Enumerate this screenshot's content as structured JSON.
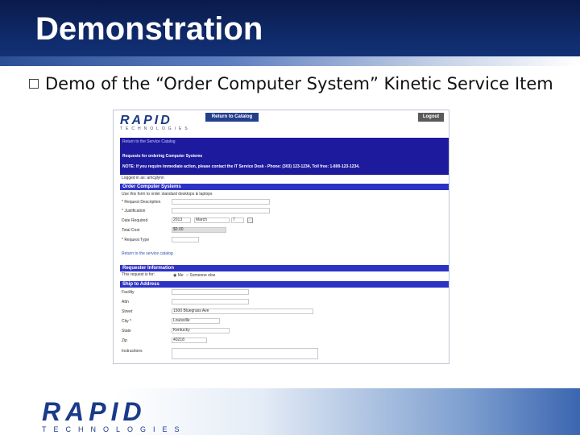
{
  "slide": {
    "title": "Demonstration",
    "bullet": "Demo of the “Order Computer System” Kinetic Service Item"
  },
  "app": {
    "logo_main": "RAPID",
    "logo_sub": "TECHNOLOGIES",
    "return_button": "Return to Catalog",
    "logout_button": "Logout",
    "banner_line1": "Return to the Service Catalog",
    "banner_line2": "Requests for ordering Computer Systems",
    "banner_line3": "NOTE: If you require immediate action, please contact the IT Service Desk - Phone: (303) 123-1234, Toll free: 1-800-123-1234.",
    "logged_in": "Logged in as: amcglynn",
    "section_order": "Order Computer Systems",
    "section_order_sub": "Use this form to order standard desktops & laptops",
    "fields": {
      "request_description": "* Request Description",
      "justification": "* Justification",
      "date_required": "Date Required",
      "date_year": "2013",
      "date_month": "March",
      "date_day": "7",
      "total_cost": "Total Cost",
      "total_cost_value": "$0.00",
      "request_type": "* Request Type"
    },
    "return_link": "Return to the service catalog",
    "section_requester": "Requester Information",
    "requester_for": "This request is for:",
    "radio_me": "Me",
    "radio_someone": "Someone else",
    "section_ship": "Ship to Address",
    "ship": {
      "facility": "Facility",
      "attn": "Attn",
      "street": "Street",
      "street_value": "1500 Bluegrass Ave",
      "city": "City *",
      "city_value": "Louisville",
      "state": "State",
      "state_value": "Kentucky",
      "zip": "Zip",
      "zip_value": "40218",
      "instructions": "Instructions"
    }
  },
  "footer": {
    "logo_main": "RAPID",
    "logo_sub": "TECHNOLOGIES"
  },
  "colors": {
    "header_bg": "#0f2a6a",
    "banner_blue": "#1e1a9e",
    "section_blue": "#2c32c4",
    "brand_blue": "#1c3a86"
  }
}
